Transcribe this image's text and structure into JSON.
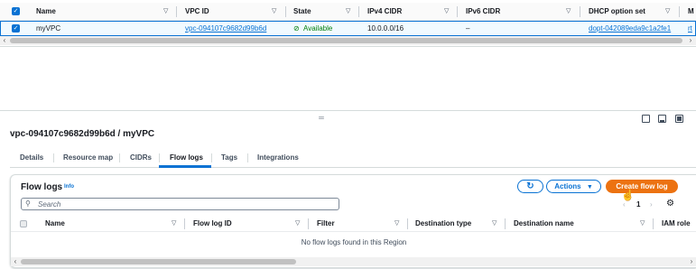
{
  "top_table": {
    "headers": [
      "Name",
      "VPC ID",
      "State",
      "IPv4 CIDR",
      "IPv6 CIDR",
      "DHCP option set",
      "M"
    ],
    "row": {
      "name": "myVPC",
      "vpc_id": "vpc-094107c9682d99b6d",
      "state": "Available",
      "ipv4": "10.0.0.0/16",
      "ipv6": "–",
      "dhcp": "dopt-042089eda9c1a2fe1",
      "more": "rt"
    }
  },
  "panel": {
    "title": "vpc-094107c9682d99b6d / myVPC",
    "tabs": [
      "Details",
      "Resource map",
      "CIDRs",
      "Flow logs",
      "Tags",
      "Integrations"
    ],
    "active_tab": "Flow logs"
  },
  "flow_logs": {
    "title": "Flow logs",
    "info": "Info",
    "actions_label": "Actions",
    "create_label": "Create flow log",
    "search_placeholder": "Search",
    "page": "1",
    "columns": [
      "Name",
      "Flow log ID",
      "Filter",
      "Destination type",
      "Destination name",
      "IAM role"
    ],
    "empty_message": "No flow logs found in this Region"
  },
  "icons": [
    "check-icon",
    "sort-icon",
    "available-icon",
    "refresh-icon",
    "caret-down-icon",
    "search-icon",
    "settings-icon",
    "chevron-left-icon",
    "chevron-right-icon",
    "panel-layout-icon",
    "drag-handle-icon",
    "cursor-icon"
  ],
  "colors": {
    "accent": "#0972d3",
    "primary_button": "#ec7211",
    "success": "#037f0c"
  }
}
